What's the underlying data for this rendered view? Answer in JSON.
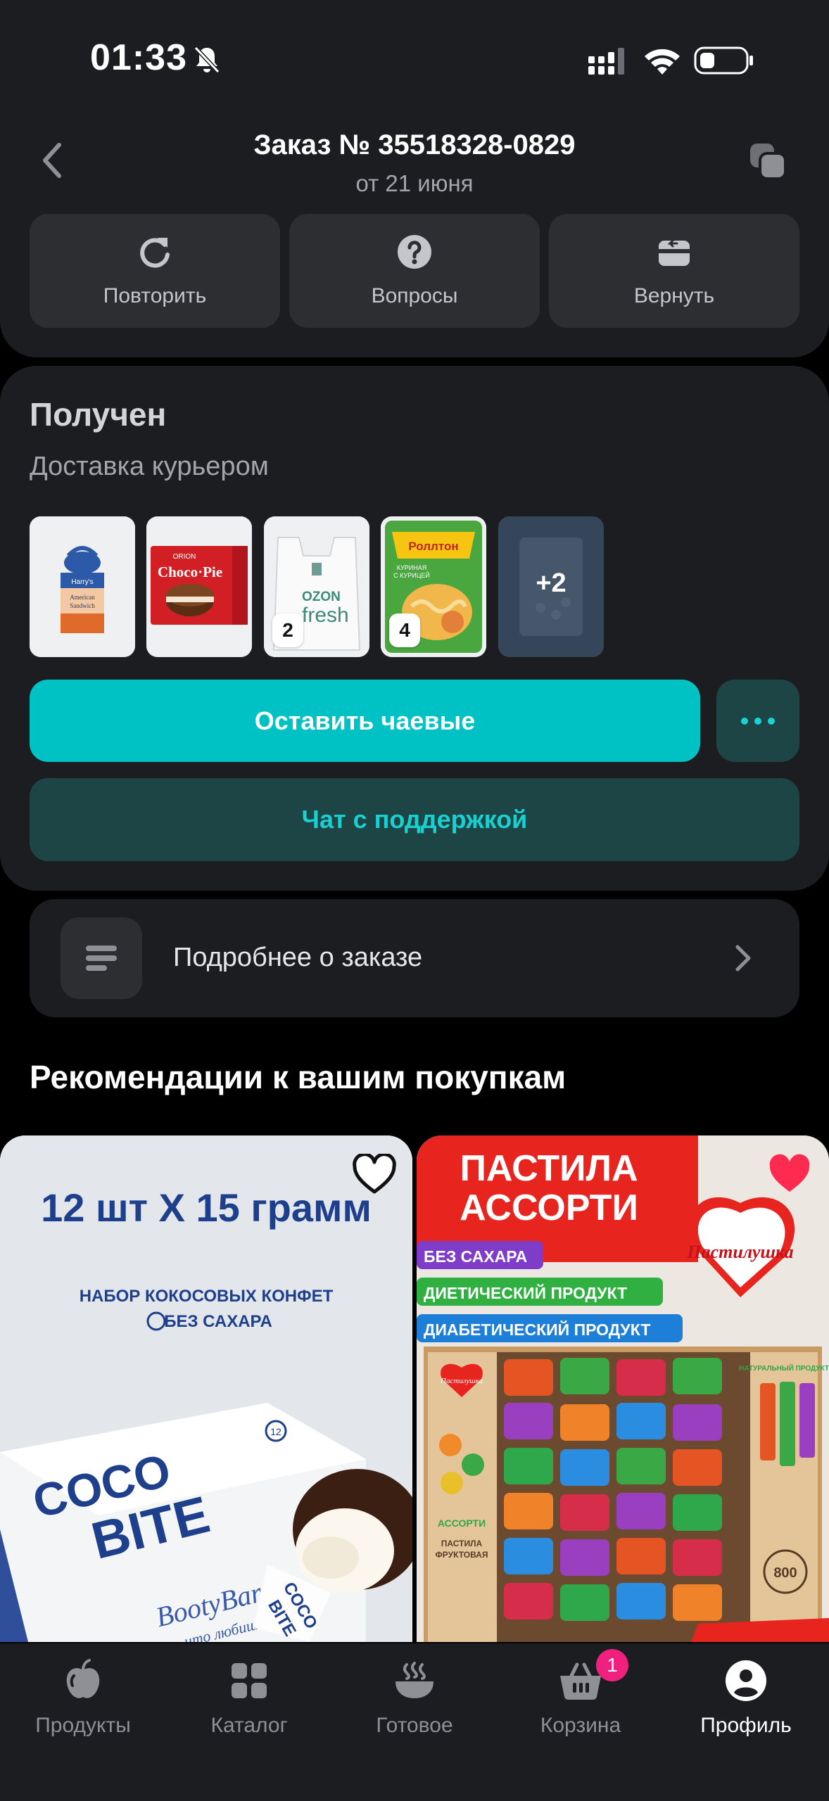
{
  "status_bar": {
    "time": "01:33",
    "battery_color": "#ffffff"
  },
  "header": {
    "title": "Заказ № 35518328-0829",
    "date": "от 21 июня"
  },
  "actions": [
    {
      "label": "Повторить",
      "icon": "repeat-icon"
    },
    {
      "label": "Вопросы",
      "icon": "question-icon"
    },
    {
      "label": "Вернуть",
      "icon": "return-box-icon"
    }
  ],
  "order_status": {
    "title": "Получен",
    "delivery": "Доставка курьером",
    "items": [
      {
        "name": "Harry's American Sandwich",
        "qty": "",
        "label_lines": [
          "Harry's",
          "American",
          "Sandwich"
        ]
      },
      {
        "name": "Choco Pie",
        "qty": "",
        "label_lines": [
          "ORION",
          "Choco·Pie"
        ]
      },
      {
        "name": "Ozon fresh bag",
        "qty": "2",
        "label_lines": [
          "OZON",
          "fresh"
        ]
      },
      {
        "name": "Rollton noodles",
        "qty": "4",
        "label_lines": [
          "Роллтон",
          "КУРИНАЯ",
          "С КУРИЦЕЙ"
        ]
      }
    ],
    "more_count": "+2"
  },
  "buttons": {
    "tip": "Оставить чаевые",
    "chat": "Чат с поддержкой"
  },
  "details": {
    "label": "Подробнее о заказе"
  },
  "recommendations": {
    "title": "Рекомендации к вашим покупкам",
    "cards": [
      {
        "favorite": false,
        "art": {
          "headline": "12 шт Х 15 грамм",
          "line1": "НАБОР КОКОСОВЫХ КОНФЕТ",
          "line2": "БЕЗ САХАРА",
          "brand1": "COCO",
          "brand2": "BITE",
          "script": "BootyBar",
          "slogan": "Знаю, что любишь",
          "mini1": "COCO",
          "mini2": "BITE",
          "weight": "12"
        }
      },
      {
        "favorite": true,
        "art": {
          "title1": "ПАСТИЛА",
          "title2": "АССОРТИ",
          "brand": "Пастилушка",
          "tag1": "БЕЗ САХАРА",
          "tag2": "ДИЕТИЧЕСКИЙ ПРОДУКТ",
          "tag3": "ДИАБЕТИЧЕСКИЙ ПРОДУКТ",
          "box_brand": "Пастилушка",
          "box1": "АССОРТИ",
          "box2": "ПАСТИЛА",
          "box3": "ФРУКТОВАЯ",
          "side": "НАТУРАЛЬНЫЙ ПРОДУКТ",
          "weight": "800"
        }
      }
    ]
  },
  "nav": {
    "items": [
      {
        "label": "Продукты",
        "icon": "apple-icon"
      },
      {
        "label": "Каталог",
        "icon": "grid-icon"
      },
      {
        "label": "Готовое",
        "icon": "hot-dish-icon"
      },
      {
        "label": "Корзина",
        "icon": "basket-icon",
        "badge": "1"
      },
      {
        "label": "Профиль",
        "icon": "profile-icon",
        "active": true
      }
    ]
  },
  "colors": {
    "accent": "#00c1c3",
    "accent_dark": "#1d4546",
    "favorite": "#ff2a4f",
    "badge": "#f0207e"
  }
}
